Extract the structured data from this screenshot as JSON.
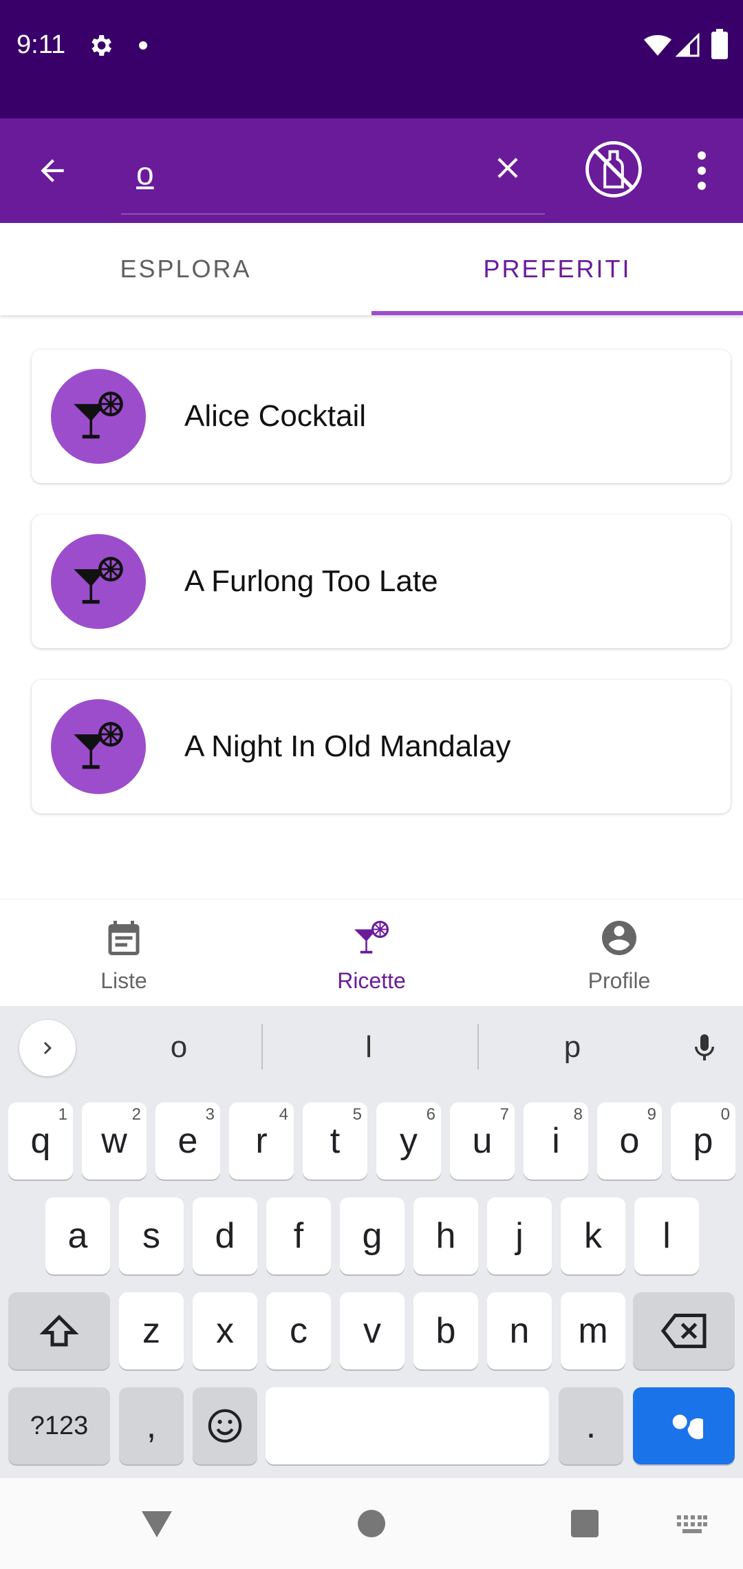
{
  "status_bar": {
    "time": "9:11",
    "icons": [
      "gear-icon",
      "notification-dot-icon",
      "wifi-icon",
      "signal-icon",
      "battery-icon"
    ]
  },
  "app_bar": {
    "search_value": "o",
    "icons": [
      "arrow-back-icon",
      "close-icon",
      "no-alcohol-icon",
      "more-vert-icon"
    ]
  },
  "tabs": [
    {
      "label": "ESPLORA",
      "selected": false
    },
    {
      "label": "PREFERITI",
      "selected": true
    }
  ],
  "favorites": [
    {
      "title": "Alice Cocktail",
      "icon": "cocktail-icon"
    },
    {
      "title": "A Furlong Too Late",
      "icon": "cocktail-icon"
    },
    {
      "title": "A Night In Old Mandalay",
      "icon": "cocktail-icon"
    }
  ],
  "bottom_nav": [
    {
      "label": "Liste",
      "icon": "calendar-list-icon",
      "selected": false
    },
    {
      "label": "Ricette",
      "icon": "cocktail-icon",
      "selected": true
    },
    {
      "label": "Profile",
      "icon": "account-circle-icon",
      "selected": false
    }
  ],
  "keyboard": {
    "suggestions": [
      "o",
      "l",
      "p"
    ],
    "row1": [
      {
        "key": "q",
        "hint": "1"
      },
      {
        "key": "w",
        "hint": "2"
      },
      {
        "key": "e",
        "hint": "3"
      },
      {
        "key": "r",
        "hint": "4"
      },
      {
        "key": "t",
        "hint": "5"
      },
      {
        "key": "y",
        "hint": "6"
      },
      {
        "key": "u",
        "hint": "7"
      },
      {
        "key": "i",
        "hint": "8"
      },
      {
        "key": "o",
        "hint": "9"
      },
      {
        "key": "p",
        "hint": "0"
      }
    ],
    "row2": [
      "a",
      "s",
      "d",
      "f",
      "g",
      "h",
      "j",
      "k",
      "l"
    ],
    "row3": [
      "z",
      "x",
      "c",
      "v",
      "b",
      "n",
      "m"
    ],
    "symbols_label": "?123",
    "comma": ",",
    "period": "."
  },
  "colors": {
    "status_bar": "#3a006a",
    "app_bar": "#6a1b9a",
    "accent": "#9c4dcc",
    "keyboard_action": "#1a73e8"
  }
}
